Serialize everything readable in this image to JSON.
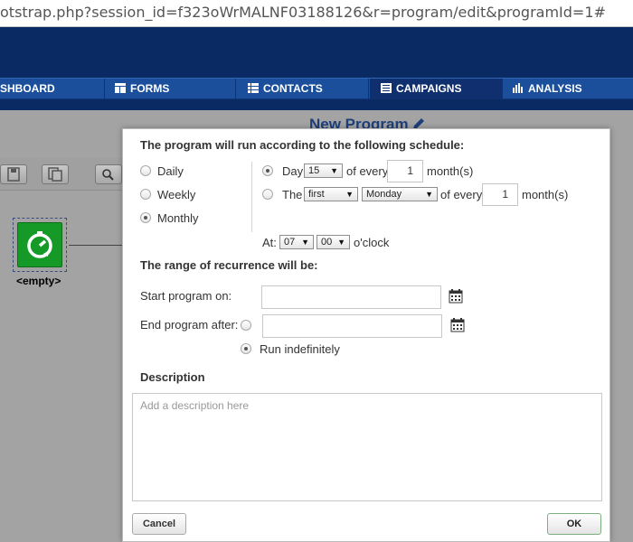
{
  "browser": {
    "url": "otstrap.php?session_id=f323oWrMALNF03188126&r=program/edit&programId=1#"
  },
  "nav": {
    "items": [
      {
        "label": "SHBOARD",
        "icon": "dashboard-icon"
      },
      {
        "label": "FORMS",
        "icon": "forms-icon"
      },
      {
        "label": "CONTACTS",
        "icon": "contacts-list-icon"
      },
      {
        "label": "CAMPAIGNS",
        "icon": "campaigns-icon",
        "active": true
      },
      {
        "label": "ANALYSIS",
        "icon": "bar-chart-icon"
      }
    ]
  },
  "page": {
    "title": "New Program",
    "tile_label": "<empty>"
  },
  "modal": {
    "schedule_heading": "The program will run according to the following schedule:",
    "frequency": {
      "options": [
        "Daily",
        "Weekly",
        "Monthly"
      ],
      "selected": "Monthly"
    },
    "day_row": {
      "prefix": "Day",
      "day_value": "15",
      "of_every": "of every",
      "months_value": "1",
      "suffix": "month(s)"
    },
    "the_row": {
      "prefix": "The",
      "ordinal_value": "first",
      "weekday_value": "Monday",
      "of_every": "of every",
      "months_value": "1",
      "suffix": "month(s)"
    },
    "time_row": {
      "prefix": "At:",
      "hour_value": "07",
      "minute_value": "00",
      "suffix": "o'clock"
    },
    "range_heading": "The range of recurrence will be:",
    "start_label": "Start program on:",
    "end_label": "End program after:",
    "run_indefinitely": "Run indefinitely",
    "description_heading": "Description",
    "description_placeholder": "Add a description here",
    "cancel_label": "Cancel",
    "ok_label": "OK"
  }
}
